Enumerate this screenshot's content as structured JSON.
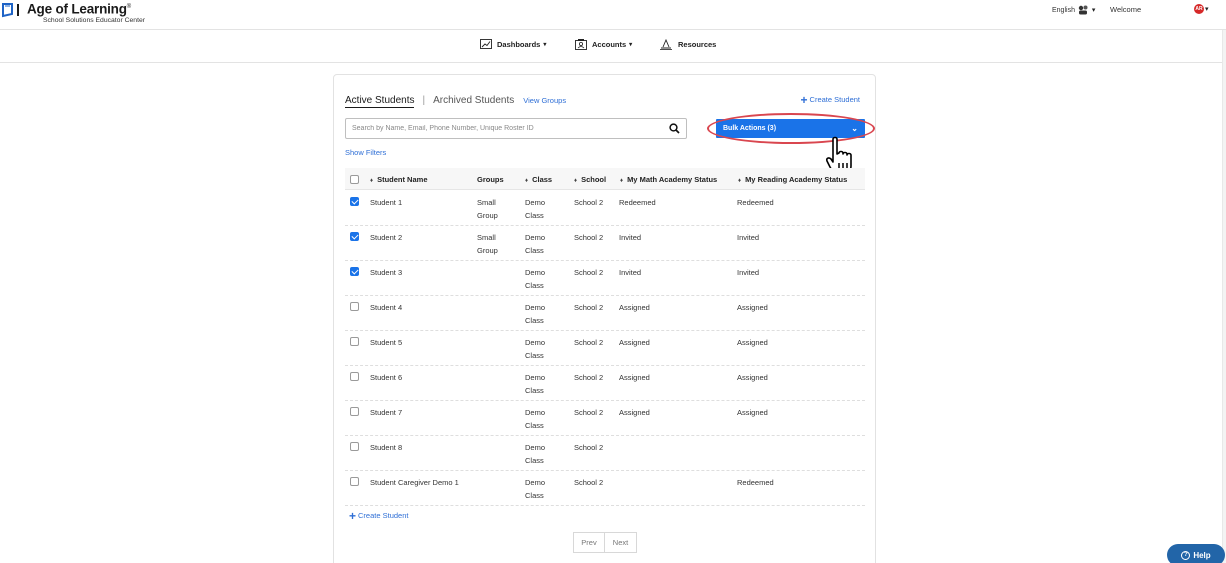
{
  "header": {
    "brand": "Age of Learning",
    "brand_tm": "®",
    "tagline": "School Solutions Educator Center",
    "language": "English",
    "language_icon": "globe-people-icon",
    "welcome": "Welcome",
    "avatar_text": "AR"
  },
  "nav": {
    "dashboards": "Dashboards",
    "accounts": "Accounts",
    "resources": "Resources"
  },
  "tabs": {
    "active": "Active Students",
    "separator": "|",
    "archived": "Archived Students",
    "view_groups": "View Groups"
  },
  "actions": {
    "create_student": "Create Student",
    "search_placeholder": "Search by Name, Email, Phone Number, Unique Roster ID",
    "bulk_actions": "Bulk Actions (3)",
    "show_filters": "Show Filters"
  },
  "table": {
    "columns": [
      "Student Name",
      "Groups",
      "Class",
      "School",
      "My Math Academy Status",
      "My Reading Academy Status"
    ],
    "rows": [
      {
        "checked": true,
        "name": "Student 1",
        "group1": "Small",
        "group2": "Group",
        "class1": "Demo",
        "class2": "Class",
        "school": "School 2",
        "math": "Redeemed",
        "reading": "Redeemed"
      },
      {
        "checked": true,
        "name": "Student 2",
        "group1": "Small",
        "group2": "Group",
        "class1": "Demo",
        "class2": "Class",
        "school": "School 2",
        "math": "Invited",
        "reading": "Invited"
      },
      {
        "checked": true,
        "name": "Student 3",
        "group1": "",
        "group2": "",
        "class1": "Demo",
        "class2": "Class",
        "school": "School 2",
        "math": "Invited",
        "reading": "Invited"
      },
      {
        "checked": false,
        "name": "Student 4",
        "group1": "",
        "group2": "",
        "class1": "Demo",
        "class2": "Class",
        "school": "School 2",
        "math": "Assigned",
        "reading": "Assigned"
      },
      {
        "checked": false,
        "name": "Student 5",
        "group1": "",
        "group2": "",
        "class1": "Demo",
        "class2": "Class",
        "school": "School 2",
        "math": "Assigned",
        "reading": "Assigned"
      },
      {
        "checked": false,
        "name": "Student 6",
        "group1": "",
        "group2": "",
        "class1": "Demo",
        "class2": "Class",
        "school": "School 2",
        "math": "Assigned",
        "reading": "Assigned"
      },
      {
        "checked": false,
        "name": "Student 7",
        "group1": "",
        "group2": "",
        "class1": "Demo",
        "class2": "Class",
        "school": "School 2",
        "math": "Assigned",
        "reading": "Assigned"
      },
      {
        "checked": false,
        "name": "Student 8",
        "group1": "",
        "group2": "",
        "class1": "Demo",
        "class2": "Class",
        "school": "School 2",
        "math": "",
        "reading": ""
      },
      {
        "checked": false,
        "name": "Student Caregiver Demo 1",
        "group1": "",
        "group2": "",
        "class1": "Demo",
        "class2": "Class",
        "school": "School 2",
        "math": "",
        "reading": "Redeemed"
      }
    ]
  },
  "pager": {
    "prev": "Prev",
    "next": "Next"
  },
  "help": {
    "label": "Help"
  },
  "colors": {
    "accent": "#1a73e8",
    "link": "#2f6fd6",
    "annotation": "#d9464f",
    "help": "#2265a8"
  }
}
